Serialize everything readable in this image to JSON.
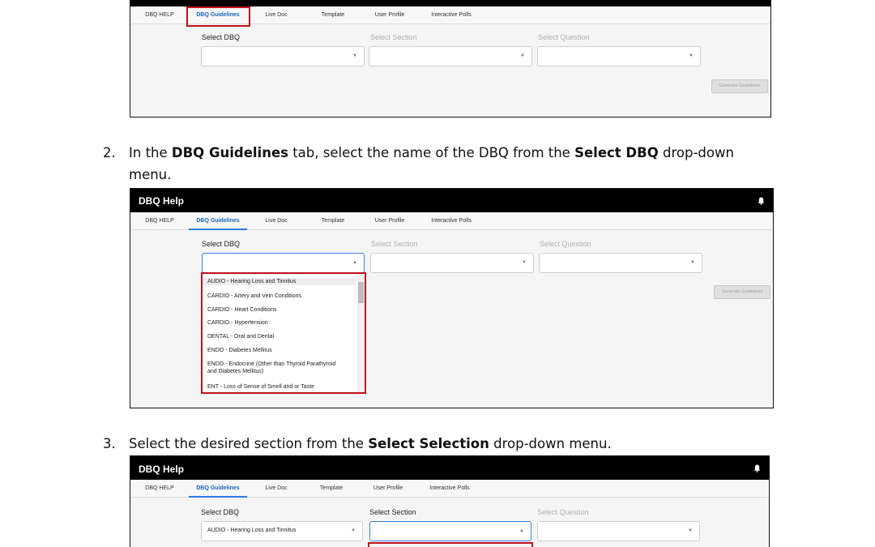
{
  "app": {
    "title": "DBQ Help",
    "bell_icon": "bell-icon",
    "tabs": [
      "DBQ HELP",
      "DBQ Guidelines",
      "Live Doc",
      "Template",
      "User Profile",
      "Interactive Polls"
    ],
    "active_tab": "DBQ Guidelines"
  },
  "form": {
    "select_dbq_label": "Select DBQ",
    "select_section_label": "Select Section",
    "select_question_label": "Select Question",
    "generate_button": "Generate Guidelines"
  },
  "dbq_options": [
    "AUDIO - Hearing Loss and Tinnitus",
    "CARDIO - Artery and Vein Conditions",
    "CARDIO - Heart Conditions",
    "CARDIO - Hypertension",
    "DENTAL - Oral and Dental",
    "ENDO - Diabetes Mellitus",
    "ENDO - Endocrine (Other than Thyroid Parathyroid",
    "and Diabetes Mellitus)",
    "ENT - Loss of Sense of Smell and or Taste"
  ],
  "selected_dbq": "AUDIO - Hearing Loss and Tinnitus",
  "steps": {
    "step2": {
      "number": "2.",
      "t1": "In the ",
      "b1": "DBQ Guidelines",
      "t2": " tab, select the name of the DBQ from the ",
      "b2": "Select DBQ",
      "t3": " drop-down",
      "line2": "menu."
    },
    "step3": {
      "number": "3.",
      "t1": "Select the desired section from the ",
      "b1": "Select Selection",
      "t2": " drop-down menu."
    }
  },
  "colors": {
    "highlight": "#c0111b",
    "active_tab": "#1565c0",
    "appbar": "#000000"
  }
}
